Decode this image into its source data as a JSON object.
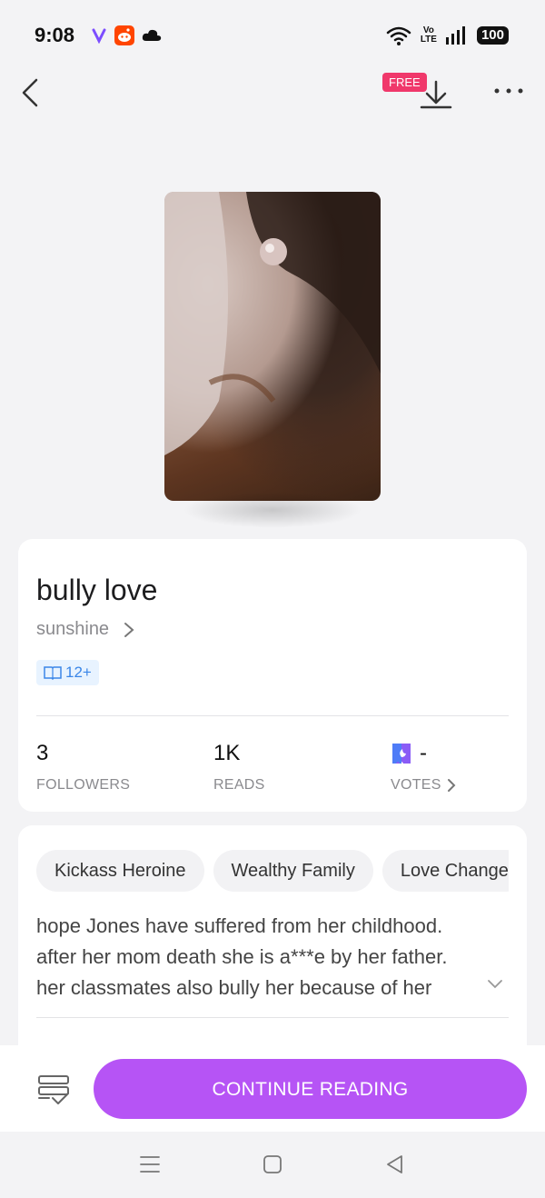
{
  "status_bar": {
    "time": "9:08",
    "battery": "100",
    "network_top": "Vo",
    "network_bottom": "LTE",
    "icons": [
      "viber-icon",
      "reddit-icon",
      "cloud-icon",
      "wifi-icon",
      "signal-icon",
      "battery-icon"
    ]
  },
  "topbar": {
    "free_badge": "FREE",
    "icons": [
      "back-arrow-icon",
      "download-icon",
      "more-dots-icon"
    ]
  },
  "book": {
    "title": "bully love",
    "author": "sunshine",
    "age_rating": "12+"
  },
  "stats": {
    "followers_value": "3",
    "followers_label": "FOLLOWERS",
    "reads_value": "1K",
    "reads_label": "READS",
    "votes_value": "-",
    "votes_label": "VOTES"
  },
  "tags": [
    "Kickass Heroine",
    "Wealthy Family",
    "Love Change"
  ],
  "description": "hope  Jones have suffered from her childhood. after her mom death she is a***e by her father. her classmates also bully her because of her",
  "bottom_bar": {
    "continue_label": "CONTINUE READING"
  },
  "colors": {
    "accent": "#b654f5",
    "free_badge": "#f0386b",
    "age_badge_bg": "#e8f3ff",
    "age_badge_text": "#3a86e8"
  }
}
